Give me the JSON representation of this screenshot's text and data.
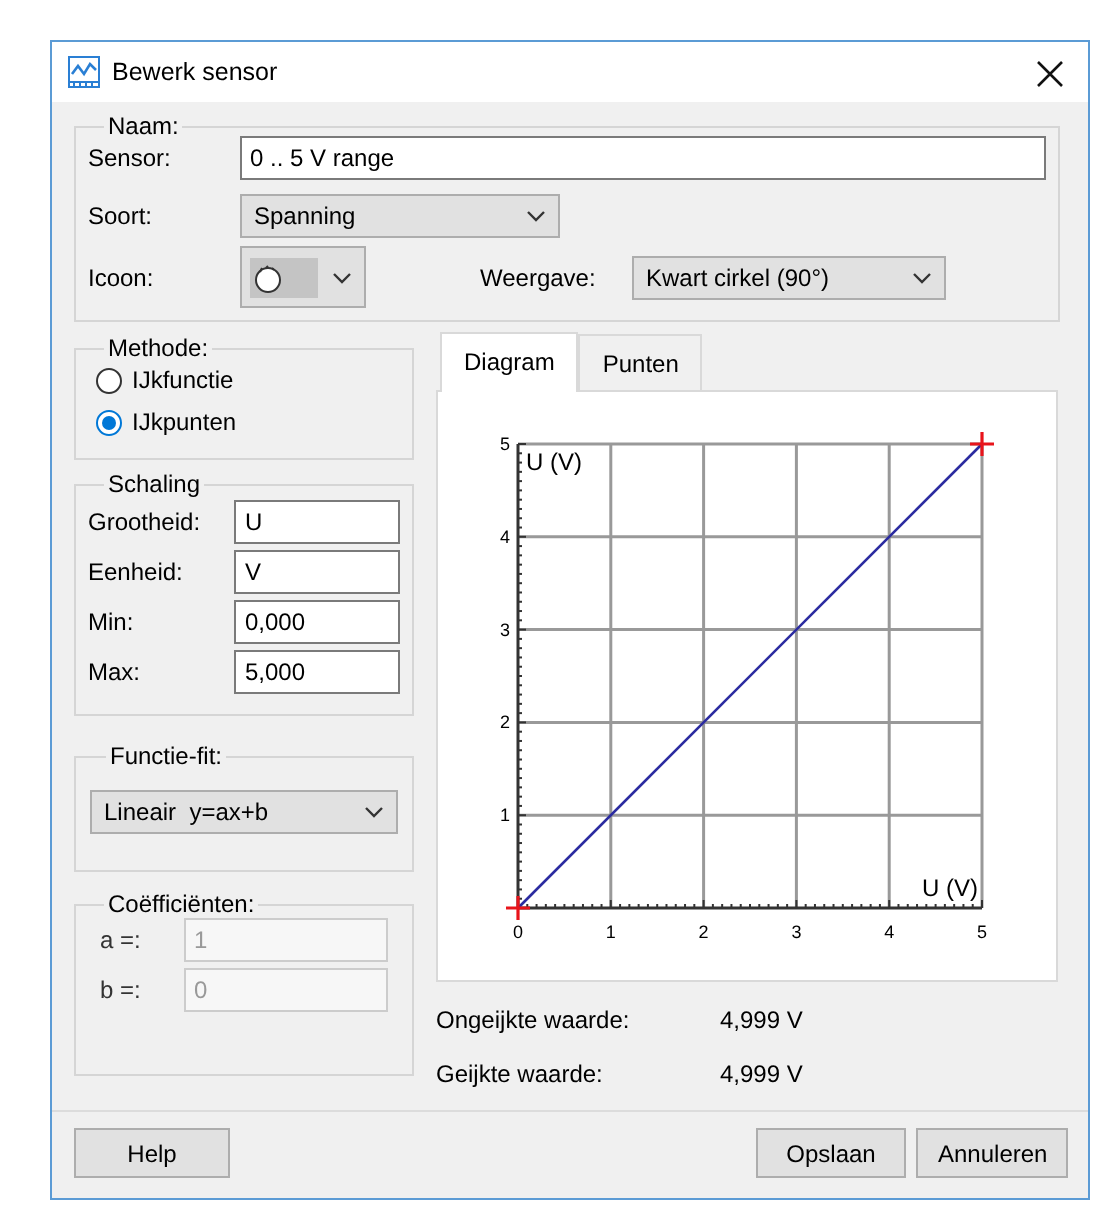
{
  "window": {
    "title": "Bewerk sensor"
  },
  "naam": {
    "legend": "Naam:",
    "sensor_label": "Sensor:",
    "sensor_value": "0 .. 5 V range",
    "soort_label": "Soort:",
    "soort_value": "Spanning",
    "icoon_label": "Icoon:",
    "weergave_label": "Weergave:",
    "weergave_value": "Kwart cirkel (90°)"
  },
  "methode": {
    "legend": "Methode:",
    "options": [
      {
        "label": "IJkfunctie",
        "selected": false
      },
      {
        "label": "IJkpunten",
        "selected": true
      }
    ]
  },
  "schaling": {
    "legend": "Schaling",
    "fields": [
      {
        "label": "Grootheid:",
        "value": "U"
      },
      {
        "label": "Eenheid:",
        "value": "V"
      },
      {
        "label": "Min:",
        "value": "0,000"
      },
      {
        "label": "Max:",
        "value": "5,000"
      }
    ]
  },
  "functie_fit": {
    "legend": "Functie-fit:",
    "value": "Lineair  y=ax+b"
  },
  "coefficienten": {
    "legend": "Coëfficiënten:",
    "fields": [
      {
        "label": "a =:",
        "value": "1",
        "disabled": true
      },
      {
        "label": "b =:",
        "value": "0",
        "disabled": true
      }
    ]
  },
  "tabs": [
    {
      "label": "Diagram",
      "selected": true
    },
    {
      "label": "Punten",
      "selected": false
    }
  ],
  "diagram": {
    "chart_data": {
      "type": "line",
      "xlabel": "U (V)",
      "ylabel": "U (V)",
      "x": [
        0,
        5
      ],
      "series": [
        {
          "color": "#2b2ba0",
          "values": [
            0,
            5
          ]
        }
      ],
      "xlim": [
        0,
        5
      ],
      "ylim": [
        0,
        5
      ],
      "grid": true,
      "xticks": [
        0,
        1,
        2,
        3,
        4,
        5
      ],
      "yticks": [
        1,
        2,
        3,
        4,
        5
      ]
    }
  },
  "readings": [
    {
      "label": "Ongeijkte waarde:",
      "value": "4,999 V"
    },
    {
      "label": "Geijkte waarde:",
      "value": "4,999 V"
    }
  ],
  "buttons": {
    "help": "Help",
    "save": "Opslaan",
    "cancel": "Annuleren"
  }
}
